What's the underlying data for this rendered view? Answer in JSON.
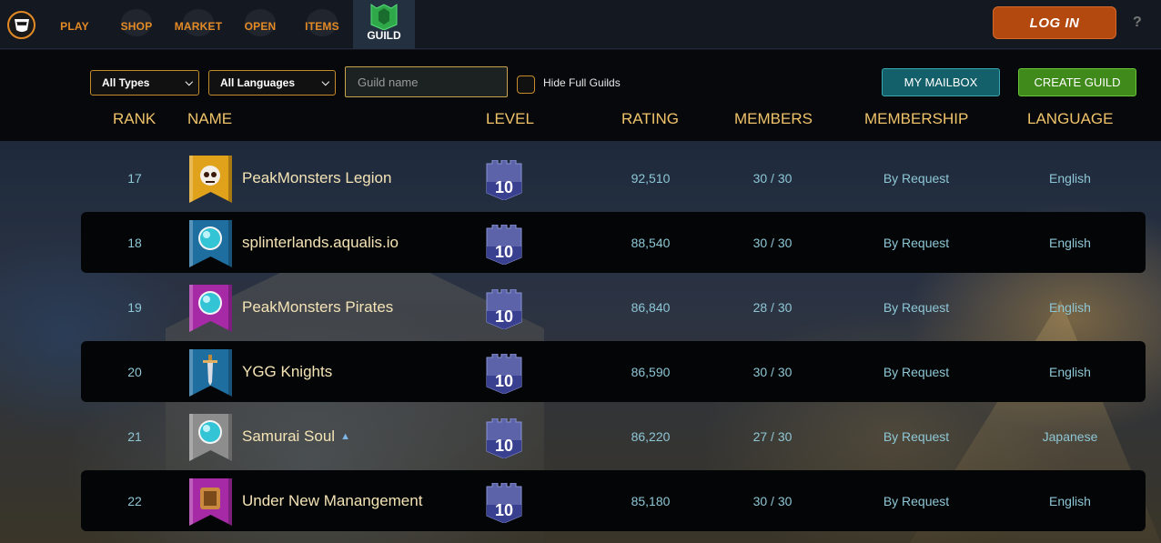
{
  "nav": {
    "items": [
      "PLAY",
      "SHOP",
      "MARKET",
      "OPEN",
      "ITEMS"
    ],
    "active": "GUILD",
    "login_label": "LOG IN",
    "help_label": "?"
  },
  "filters": {
    "type_value": "All Types",
    "language_value": "All Languages",
    "guild_name_placeholder": "Guild name",
    "hide_full_label": "Hide Full Guilds",
    "mailbox_label": "MY MAILBOX",
    "create_label": "CREATE GUILD"
  },
  "columns": [
    "RANK",
    "NAME",
    "LEVEL",
    "RATING",
    "MEMBERS",
    "MEMBERSHIP",
    "LANGUAGE"
  ],
  "rows": [
    {
      "rank": "17",
      "name": "PeakMonsters Legion",
      "level": "10",
      "rating": "92,510",
      "members": "30 / 30",
      "membership": "By Request",
      "language": "English",
      "banner_color": "#e0a21a",
      "emblem": "skull-icon"
    },
    {
      "rank": "18",
      "name": "splinterlands.aqualis.io",
      "level": "10",
      "rating": "88,540",
      "members": "30 / 30",
      "membership": "By Request",
      "language": "English",
      "banner_color": "#1f6ea0",
      "emblem": "orb-icon"
    },
    {
      "rank": "19",
      "name": "PeakMonsters Pirates",
      "level": "10",
      "rating": "86,840",
      "members": "28 / 30",
      "membership": "By Request",
      "language": "English",
      "banner_color": "#a62aa6",
      "emblem": "orb-icon"
    },
    {
      "rank": "20",
      "name": "YGG Knights",
      "level": "10",
      "rating": "86,590",
      "members": "30 / 30",
      "membership": "By Request",
      "language": "English",
      "banner_color": "#1f6ea0",
      "emblem": "sword-icon"
    },
    {
      "rank": "21",
      "name": "Samurai Soul",
      "level": "10",
      "rating": "86,220",
      "members": "27 / 30",
      "membership": "By Request",
      "language": "Japanese",
      "banner_color": "#8d8d8d",
      "emblem": "orb-icon"
    },
    {
      "rank": "22",
      "name": "Under New Manangement",
      "level": "10",
      "rating": "85,180",
      "members": "30 / 30",
      "membership": "By Request",
      "language": "English",
      "banner_color": "#a62aa6",
      "emblem": "scroll-icon"
    }
  ],
  "colors": {
    "accent_orange": "#e38a25",
    "header_gold": "#f0c36b",
    "cell_teal": "#8ec7d6",
    "name_cream": "#f4e3b5"
  }
}
